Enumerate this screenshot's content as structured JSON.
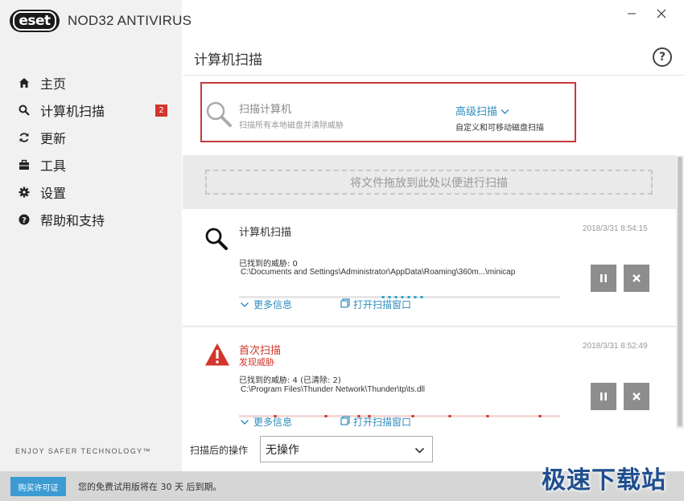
{
  "app": {
    "logo_text": "eset",
    "product_name": "NOD32 ANTIVIRUS",
    "tagline": "ENJOY SAFER TECHNOLOGY™"
  },
  "colors": {
    "accent": "#2d8dbf",
    "danger": "#d2352b",
    "sidebar_bg": "#f1f1f1",
    "button_gray": "#8d8d8d"
  },
  "sidebar": {
    "items": [
      {
        "label": "主页",
        "icon": "home-icon"
      },
      {
        "label": "计算机扫描",
        "icon": "search-icon",
        "badge": "2"
      },
      {
        "label": "更新",
        "icon": "refresh-icon"
      },
      {
        "label": "工具",
        "icon": "toolbox-icon"
      },
      {
        "label": "设置",
        "icon": "gear-icon"
      },
      {
        "label": "帮助和支持",
        "icon": "question-icon"
      }
    ]
  },
  "header": {
    "title": "计算机扫描",
    "help": "?"
  },
  "scan_options": {
    "main": {
      "title": "扫描计算机",
      "subtitle": "扫描所有本地磁盘并清除威胁"
    },
    "advanced": {
      "title": "高级扫描",
      "subtitle": "自定义和可移动磁盘扫描"
    }
  },
  "drop_zone": {
    "label": "将文件拖放到此处以便进行扫描"
  },
  "scans": [
    {
      "title": "计算机扫描",
      "timestamp": "2018/3/31 8:54:15",
      "threats": "已找到的威胁: 0",
      "path": "C:\\Documents and Settings\\Administrator\\AppData\\Roaming\\360m...\\minicap",
      "more_info": "更多信息",
      "open_window": "打开扫描窗口"
    },
    {
      "title": "首次扫描",
      "subtitle": "发现威胁",
      "timestamp": "2018/3/31 8:52:49",
      "threats": "已找到的威胁: 4 (已清除: 2)",
      "path": "C:\\Program Files\\Thunder Network\\Thunder\\tp\\ts.dll",
      "more_info": "更多信息",
      "open_window": "打开扫描窗口"
    }
  ],
  "footer": {
    "after_scan_label": "扫描后的操作",
    "after_scan_value": "无操作",
    "buy_label": "购买许可证",
    "trial_text": "您的免费试用版将在 30 天 后到期。"
  },
  "watermark": "极速下载站"
}
